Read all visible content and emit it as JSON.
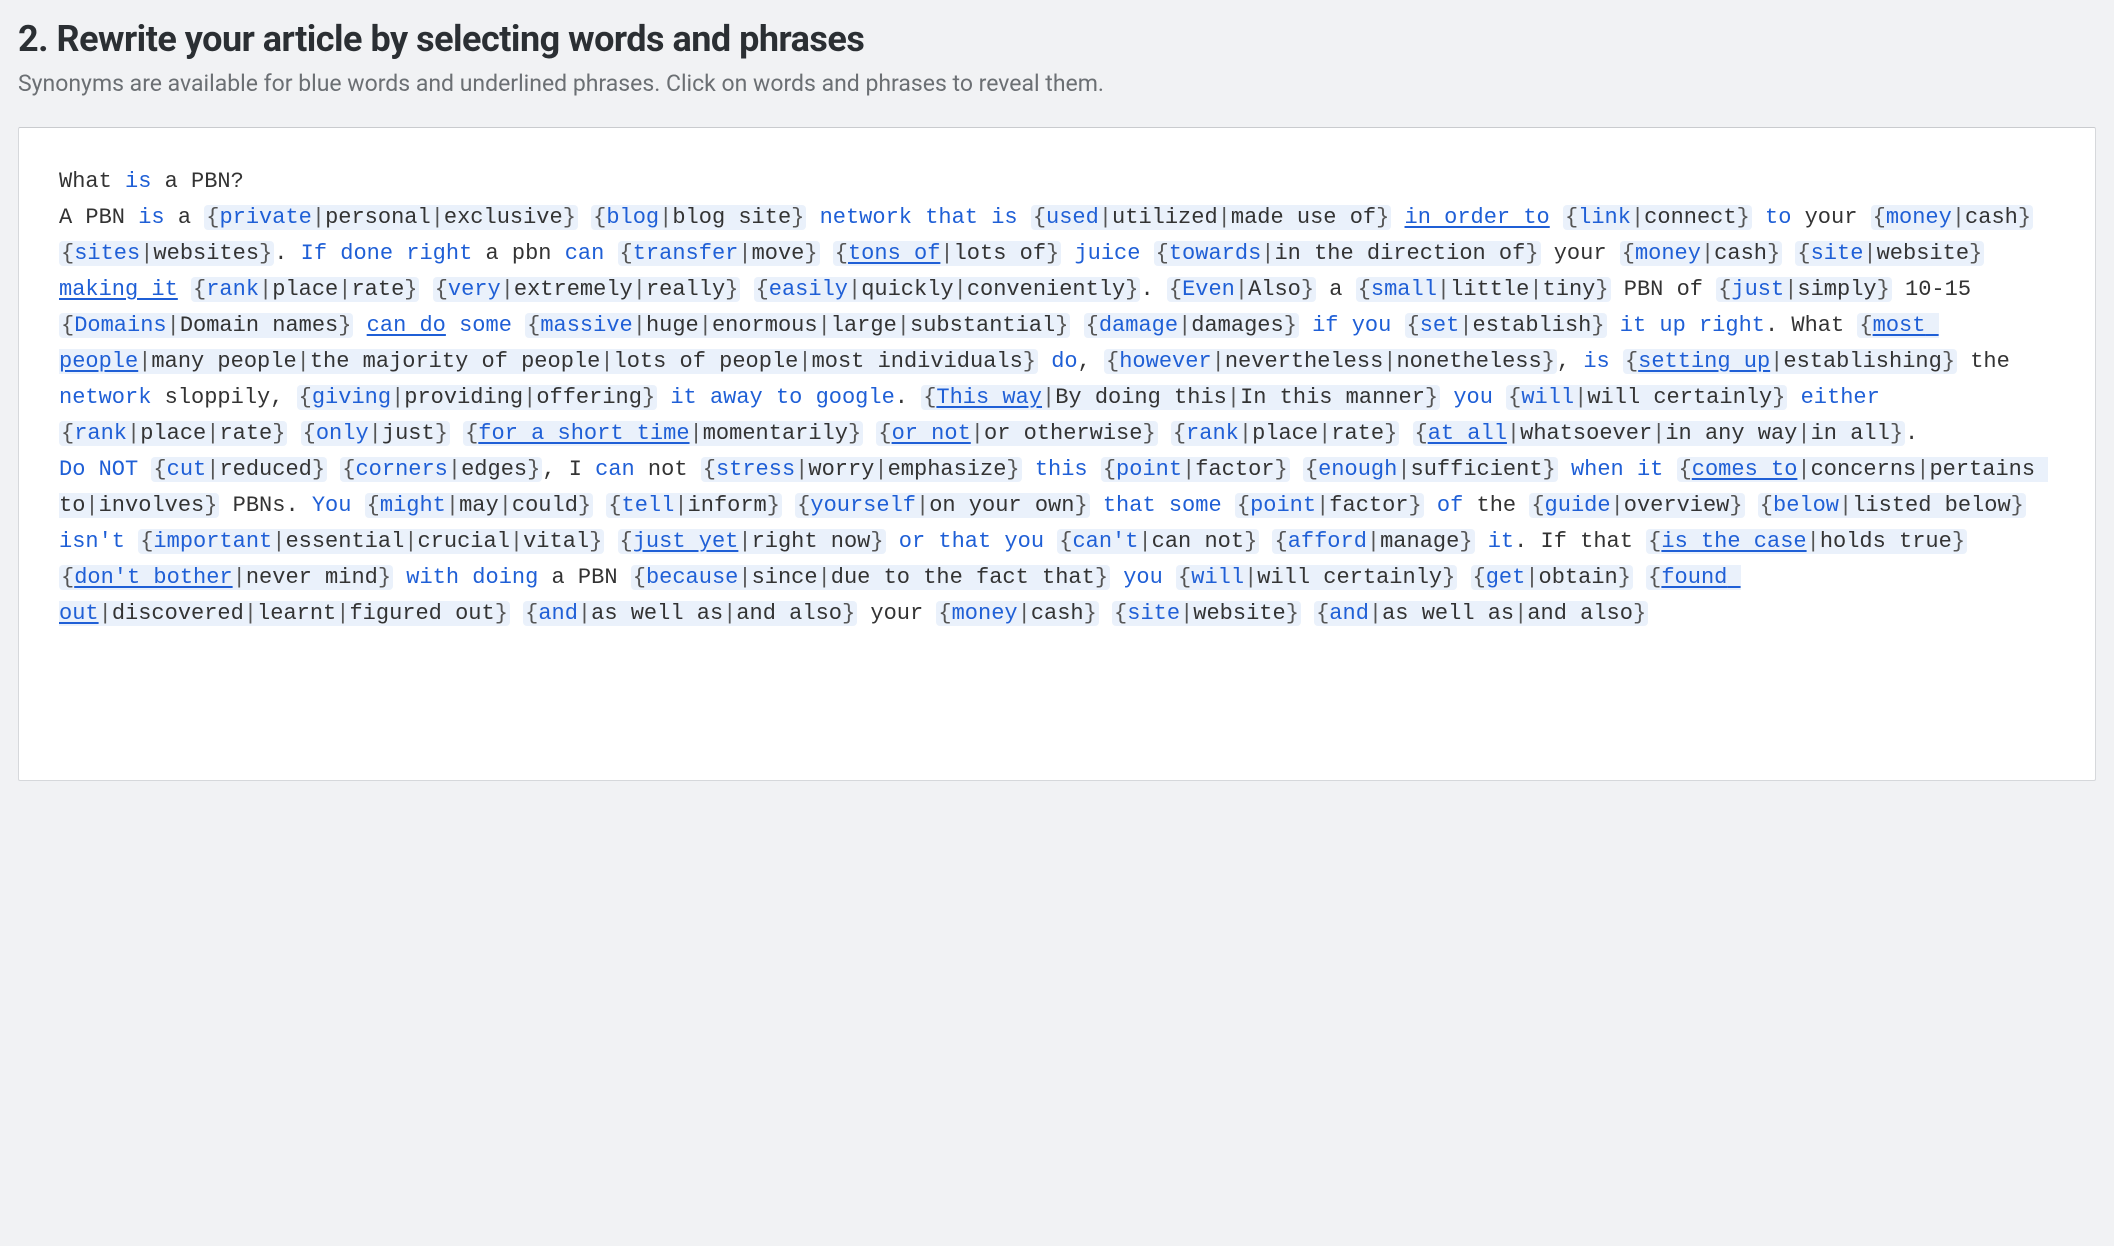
{
  "heading": "2. Rewrite your article by selecting words and phrases",
  "subtitle": "Synonyms are available for blue words and underlined phrases. Click on words and phrases to reveal them.",
  "content": [
    [
      {
        "type": "t",
        "text": "What "
      },
      {
        "type": "kw",
        "text": "is"
      },
      {
        "type": "t",
        "text": " a PBN?"
      }
    ],
    [
      {
        "type": "t",
        "text": "A PBN "
      },
      {
        "type": "kw",
        "text": "is"
      },
      {
        "type": "t",
        "text": " a "
      },
      {
        "type": "grp",
        "def": "private",
        "alts": [
          "personal",
          "exclusive"
        ]
      },
      {
        "type": "t",
        "text": " "
      },
      {
        "type": "grp",
        "def": "blog",
        "alts": [
          "blog site"
        ]
      },
      {
        "type": "t",
        "text": " "
      },
      {
        "type": "kw",
        "text": "network"
      },
      {
        "type": "t",
        "text": " "
      },
      {
        "type": "kw",
        "text": "that is"
      },
      {
        "type": "t",
        "text": " "
      },
      {
        "type": "grp",
        "def": "used",
        "alts": [
          "utilized",
          "made use of"
        ]
      },
      {
        "type": "t",
        "text": " "
      },
      {
        "type": "ku",
        "text": "in order to"
      },
      {
        "type": "t",
        "text": " "
      },
      {
        "type": "grp",
        "def": "link",
        "alts": [
          "connect"
        ]
      },
      {
        "type": "t",
        "text": " "
      },
      {
        "type": "kw",
        "text": "to"
      },
      {
        "type": "t",
        "text": " your "
      },
      {
        "type": "grp",
        "def": "money",
        "alts": [
          "cash"
        ]
      },
      {
        "type": "t",
        "text": " "
      },
      {
        "type": "grp",
        "def": "sites",
        "alts": [
          "websites"
        ]
      },
      {
        "type": "t",
        "text": ". "
      },
      {
        "type": "kw",
        "text": "If done right"
      },
      {
        "type": "t",
        "text": " a pbn "
      },
      {
        "type": "kw",
        "text": "can"
      },
      {
        "type": "t",
        "text": " "
      },
      {
        "type": "grp",
        "def": "transfer",
        "alts": [
          "move"
        ]
      },
      {
        "type": "t",
        "text": " "
      },
      {
        "type": "grp",
        "def": "tons of",
        "defu": true,
        "alts": [
          "lots of"
        ]
      },
      {
        "type": "t",
        "text": " "
      },
      {
        "type": "kw",
        "text": "juice"
      },
      {
        "type": "t",
        "text": " "
      },
      {
        "type": "grp",
        "def": "towards",
        "alts": [
          "in the direction of"
        ]
      },
      {
        "type": "t",
        "text": " your "
      },
      {
        "type": "grp",
        "def": "money",
        "alts": [
          "cash"
        ]
      },
      {
        "type": "t",
        "text": " "
      },
      {
        "type": "grp",
        "def": "site",
        "alts": [
          "website"
        ]
      },
      {
        "type": "t",
        "text": " "
      },
      {
        "type": "ku",
        "text": "making it"
      },
      {
        "type": "t",
        "text": " "
      },
      {
        "type": "grp",
        "def": "rank",
        "alts": [
          "place",
          "rate"
        ]
      },
      {
        "type": "t",
        "text": " "
      },
      {
        "type": "grp",
        "def": "very",
        "alts": [
          "extremely",
          "really"
        ]
      },
      {
        "type": "t",
        "text": " "
      },
      {
        "type": "grp",
        "def": "easily",
        "alts": [
          "quickly",
          "conveniently"
        ]
      },
      {
        "type": "t",
        "text": ". "
      },
      {
        "type": "grp",
        "def": "Even",
        "alts": [
          "Also"
        ]
      },
      {
        "type": "t",
        "text": " a "
      },
      {
        "type": "grp",
        "def": "small",
        "alts": [
          "little",
          "tiny"
        ]
      },
      {
        "type": "t",
        "text": " PBN of "
      },
      {
        "type": "grp",
        "def": "just",
        "alts": [
          "simply"
        ]
      },
      {
        "type": "t",
        "text": " 10-15 "
      },
      {
        "type": "grp",
        "def": "Domains",
        "alts": [
          "Domain names"
        ]
      },
      {
        "type": "t",
        "text": " "
      },
      {
        "type": "ku",
        "text": "can do"
      },
      {
        "type": "t",
        "text": " "
      },
      {
        "type": "kw",
        "text": "some"
      },
      {
        "type": "t",
        "text": " "
      },
      {
        "type": "grp",
        "def": "massive",
        "alts": [
          "huge",
          "enormous",
          "large",
          "substantial"
        ]
      },
      {
        "type": "t",
        "text": " "
      },
      {
        "type": "grp",
        "def": "damage",
        "alts": [
          "damages"
        ]
      },
      {
        "type": "t",
        "text": " "
      },
      {
        "type": "kw",
        "text": "if you"
      },
      {
        "type": "t",
        "text": " "
      },
      {
        "type": "grp",
        "def": "set",
        "alts": [
          "establish"
        ]
      },
      {
        "type": "t",
        "text": " "
      },
      {
        "type": "kw",
        "text": "it"
      },
      {
        "type": "t",
        "text": " "
      },
      {
        "type": "kw",
        "text": "up right"
      },
      {
        "type": "t",
        "text": ". What "
      },
      {
        "type": "grp",
        "def": "most people",
        "defu": true,
        "alts": [
          "many people",
          "the majority of people",
          "lots of people",
          "most individuals"
        ]
      },
      {
        "type": "t",
        "text": " "
      },
      {
        "type": "kw",
        "text": "do"
      },
      {
        "type": "t",
        "text": ", "
      },
      {
        "type": "grp",
        "def": "however",
        "alts": [
          "nevertheless",
          "nonetheless"
        ]
      },
      {
        "type": "t",
        "text": ", "
      },
      {
        "type": "kw",
        "text": "is"
      },
      {
        "type": "t",
        "text": " "
      },
      {
        "type": "grp",
        "def": "setting up",
        "defu": true,
        "alts": [
          "establishing"
        ]
      },
      {
        "type": "t",
        "text": " the "
      },
      {
        "type": "kw",
        "text": "network"
      },
      {
        "type": "t",
        "text": " sloppily, "
      },
      {
        "type": "grp",
        "def": "giving",
        "alts": [
          "providing",
          "offering"
        ]
      },
      {
        "type": "t",
        "text": " "
      },
      {
        "type": "kw",
        "text": "it away to google"
      },
      {
        "type": "t",
        "text": ". "
      },
      {
        "type": "grp",
        "def": "This way",
        "defu": true,
        "alts": [
          "By doing this",
          "In this manner"
        ]
      },
      {
        "type": "t",
        "text": " "
      },
      {
        "type": "kw",
        "text": "you"
      },
      {
        "type": "t",
        "text": " "
      },
      {
        "type": "grp",
        "def": "will",
        "alts": [
          "will certainly"
        ]
      },
      {
        "type": "t",
        "text": " "
      },
      {
        "type": "kw",
        "text": "either"
      },
      {
        "type": "t",
        "text": " "
      },
      {
        "type": "grp",
        "def": "rank",
        "alts": [
          "place",
          "rate"
        ]
      },
      {
        "type": "t",
        "text": " "
      },
      {
        "type": "grp",
        "def": "only",
        "alts": [
          "just"
        ]
      },
      {
        "type": "t",
        "text": " "
      },
      {
        "type": "grp",
        "def": "for a short time",
        "defu": true,
        "alts": [
          "momentarily"
        ]
      },
      {
        "type": "t",
        "text": " "
      },
      {
        "type": "grp",
        "def": "or not",
        "defu": true,
        "alts": [
          "or otherwise"
        ]
      },
      {
        "type": "t",
        "text": " "
      },
      {
        "type": "grp",
        "def": "rank",
        "alts": [
          "place",
          "rate"
        ]
      },
      {
        "type": "t",
        "text": " "
      },
      {
        "type": "grp",
        "def": "at all",
        "defu": true,
        "alts": [
          "whatsoever",
          "in any way",
          "in all"
        ]
      },
      {
        "type": "t",
        "text": "."
      }
    ],
    [
      {
        "type": "kw",
        "text": "Do"
      },
      {
        "type": "t",
        "text": " "
      },
      {
        "type": "kw",
        "text": "NOT"
      },
      {
        "type": "t",
        "text": " "
      },
      {
        "type": "grp",
        "def": "cut",
        "alts": [
          "reduced"
        ]
      },
      {
        "type": "t",
        "text": " "
      },
      {
        "type": "grp",
        "def": "corners",
        "alts": [
          "edges"
        ]
      },
      {
        "type": "t",
        "text": ", I "
      },
      {
        "type": "kw",
        "text": "can"
      },
      {
        "type": "t",
        "text": " not "
      },
      {
        "type": "grp",
        "def": "stress",
        "alts": [
          "worry",
          "emphasize"
        ]
      },
      {
        "type": "t",
        "text": " "
      },
      {
        "type": "kw",
        "text": "this"
      },
      {
        "type": "t",
        "text": " "
      },
      {
        "type": "grp",
        "def": "point",
        "alts": [
          "factor"
        ]
      },
      {
        "type": "t",
        "text": " "
      },
      {
        "type": "grp",
        "def": "enough",
        "alts": [
          "sufficient"
        ]
      },
      {
        "type": "t",
        "text": " "
      },
      {
        "type": "kw",
        "text": "when it"
      },
      {
        "type": "t",
        "text": " "
      },
      {
        "type": "grp",
        "def": "comes to",
        "defu": true,
        "alts": [
          "concerns",
          "pertains to",
          "involves"
        ]
      },
      {
        "type": "t",
        "text": " PBNs. "
      },
      {
        "type": "kw",
        "text": "You"
      },
      {
        "type": "t",
        "text": " "
      },
      {
        "type": "grp",
        "def": "might",
        "alts": [
          "may",
          "could"
        ]
      },
      {
        "type": "t",
        "text": " "
      },
      {
        "type": "grp",
        "def": "tell",
        "alts": [
          "inform"
        ]
      },
      {
        "type": "t",
        "text": " "
      },
      {
        "type": "grp",
        "def": "yourself",
        "alts": [
          "on your own"
        ]
      },
      {
        "type": "t",
        "text": " "
      },
      {
        "type": "kw",
        "text": "that some"
      },
      {
        "type": "t",
        "text": " "
      },
      {
        "type": "grp",
        "def": "point",
        "alts": [
          "factor"
        ]
      },
      {
        "type": "t",
        "text": " "
      },
      {
        "type": "kw",
        "text": "of"
      },
      {
        "type": "t",
        "text": " the "
      },
      {
        "type": "grp",
        "def": "guide",
        "alts": [
          "overview"
        ]
      },
      {
        "type": "t",
        "text": " "
      },
      {
        "type": "grp",
        "def": "below",
        "alts": [
          "listed below"
        ]
      },
      {
        "type": "t",
        "text": " "
      },
      {
        "type": "kw",
        "text": "isn't"
      },
      {
        "type": "t",
        "text": " "
      },
      {
        "type": "grp",
        "def": "important",
        "alts": [
          "essential",
          "crucial",
          "vital"
        ]
      },
      {
        "type": "t",
        "text": " "
      },
      {
        "type": "grp",
        "def": "just yet",
        "defu": true,
        "alts": [
          "right now"
        ]
      },
      {
        "type": "t",
        "text": " "
      },
      {
        "type": "kw",
        "text": "or that you"
      },
      {
        "type": "t",
        "text": " "
      },
      {
        "type": "grp",
        "def": "can't",
        "alts": [
          "can not"
        ]
      },
      {
        "type": "t",
        "text": " "
      },
      {
        "type": "grp",
        "def": "afford",
        "alts": [
          "manage"
        ]
      },
      {
        "type": "t",
        "text": " "
      },
      {
        "type": "kw",
        "text": "it"
      },
      {
        "type": "t",
        "text": ". If that "
      },
      {
        "type": "grp",
        "def": "is the case",
        "defu": true,
        "alts": [
          "holds true"
        ]
      },
      {
        "type": "t",
        "text": " "
      },
      {
        "type": "grp",
        "def": "don't bother",
        "defu": true,
        "alts": [
          "never mind"
        ]
      },
      {
        "type": "t",
        "text": " "
      },
      {
        "type": "kw",
        "text": "with doing"
      },
      {
        "type": "t",
        "text": " a PBN "
      },
      {
        "type": "grp",
        "def": "because",
        "alts": [
          "since",
          "due to the fact that"
        ]
      },
      {
        "type": "t",
        "text": " "
      },
      {
        "type": "kw",
        "text": "you"
      },
      {
        "type": "t",
        "text": " "
      },
      {
        "type": "grp",
        "def": "will",
        "alts": [
          "will certainly"
        ]
      },
      {
        "type": "t",
        "text": " "
      },
      {
        "type": "grp",
        "def": "get",
        "alts": [
          "obtain"
        ]
      },
      {
        "type": "t",
        "text": " "
      },
      {
        "type": "grp",
        "def": "found out",
        "defu": true,
        "alts": [
          "discovered",
          "learnt",
          "figured out"
        ]
      },
      {
        "type": "t",
        "text": " "
      },
      {
        "type": "grp",
        "def": "and",
        "alts": [
          "as well as",
          "and also"
        ]
      },
      {
        "type": "t",
        "text": " your "
      },
      {
        "type": "grp",
        "def": "money",
        "alts": [
          "cash"
        ]
      },
      {
        "type": "t",
        "text": " "
      },
      {
        "type": "grp",
        "def": "site",
        "alts": [
          "website"
        ]
      },
      {
        "type": "t",
        "text": " "
      },
      {
        "type": "grp",
        "def": "and",
        "alts": [
          "as well as",
          "and also"
        ]
      }
    ]
  ]
}
